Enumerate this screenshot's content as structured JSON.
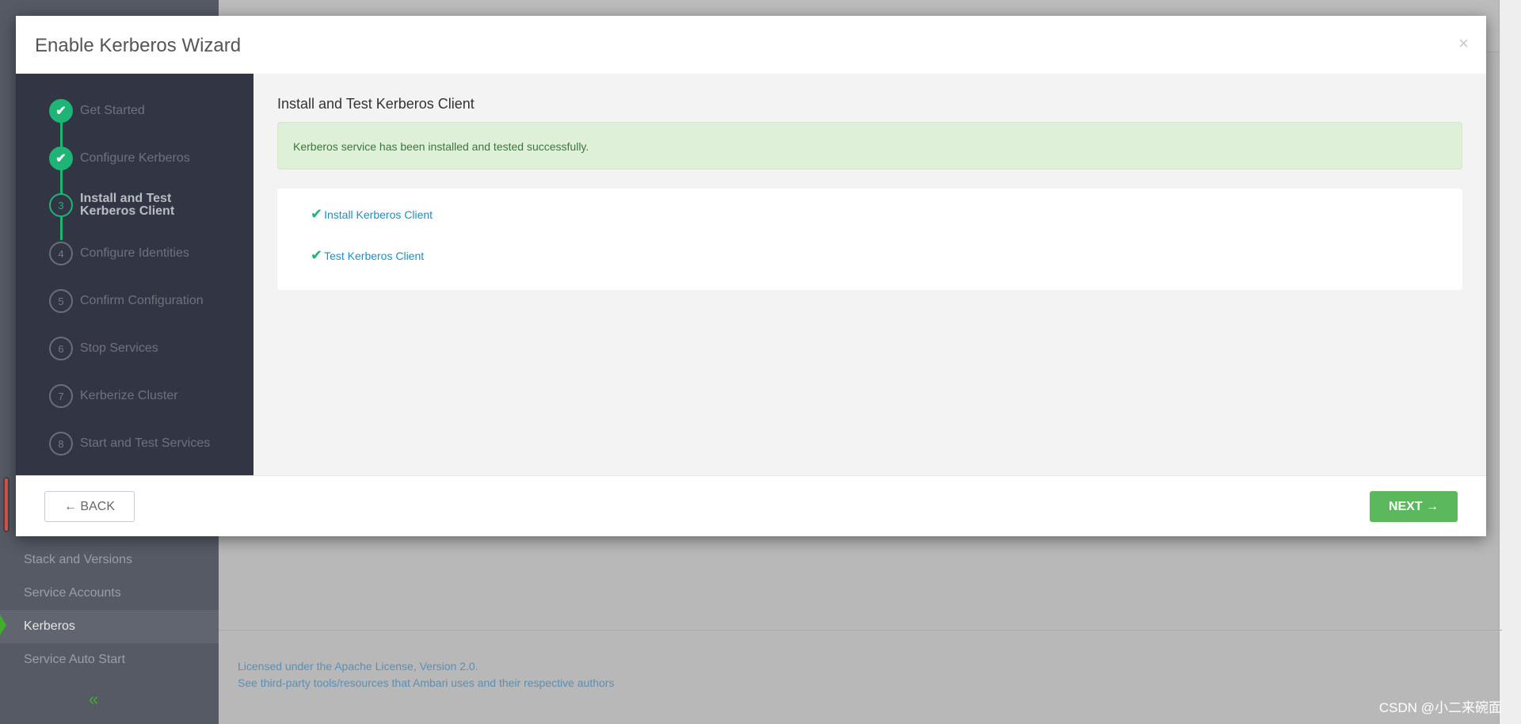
{
  "app_sidebar": {
    "items": [
      {
        "label": "Stack and Versions",
        "active": false
      },
      {
        "label": "Service Accounts",
        "active": false
      },
      {
        "label": "Kerberos",
        "active": true
      },
      {
        "label": "Service Auto Start",
        "active": false
      }
    ],
    "collapse_icon": "double-chevron-left"
  },
  "footer": {
    "license": "Licensed under the Apache License, Version 2.0.",
    "third_party": "See third-party tools/resources that Ambari uses and their respective authors"
  },
  "watermark": "CSDN @小二来碗面",
  "modal": {
    "title": "Enable Kerberos Wizard",
    "close": "×",
    "steps": [
      {
        "num": "1",
        "label": "Get Started",
        "state": "done"
      },
      {
        "num": "2",
        "label": "Configure Kerberos",
        "state": "done"
      },
      {
        "num": "3",
        "label": "Install and Test Kerberos Client",
        "state": "current"
      },
      {
        "num": "4",
        "label": "Configure Identities",
        "state": "todo"
      },
      {
        "num": "5",
        "label": "Confirm Configuration",
        "state": "todo"
      },
      {
        "num": "6",
        "label": "Stop Services",
        "state": "todo"
      },
      {
        "num": "7",
        "label": "Kerberize Cluster",
        "state": "todo"
      },
      {
        "num": "8",
        "label": "Start and Test Services",
        "state": "todo"
      }
    ],
    "content_title": "Install and Test Kerberos Client",
    "alert": "Kerberos service has been installed and tested successfully.",
    "tasks": [
      {
        "label": "Install Kerberos Client",
        "status": "success"
      },
      {
        "label": "Test Kerberos Client",
        "status": "success"
      }
    ],
    "back_label": "← BACK",
    "next_label": "NEXT →"
  },
  "colors": {
    "accent": "#1eb475",
    "next": "#5cb85c",
    "alert_bg": "#dff0d8",
    "sidebar": "#323544"
  }
}
